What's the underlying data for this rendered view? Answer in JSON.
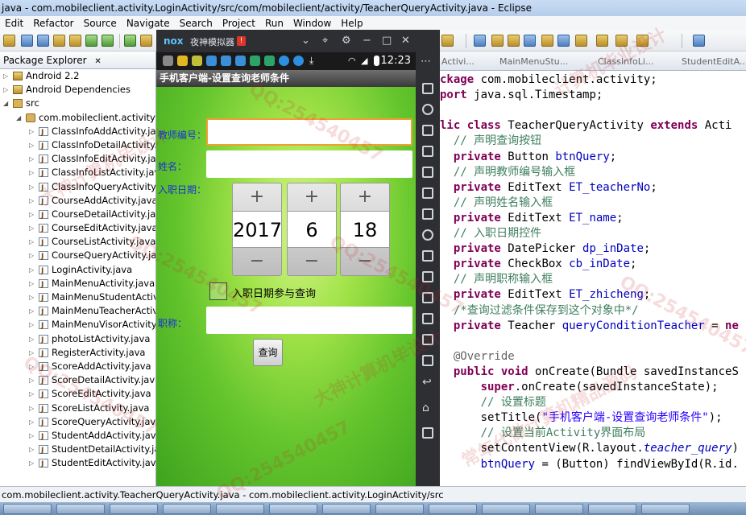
{
  "window": {
    "title": "java - com.mobileclient.activity.LoginActivity/src/com/mobileclient/activity/TeacherQueryActivity.java - Eclipse"
  },
  "menu": [
    "Edit",
    "Refactor",
    "Source",
    "Navigate",
    "Search",
    "Project",
    "Run",
    "Window",
    "Help"
  ],
  "package_explorer": {
    "tab": "Package Explorer",
    "items": [
      {
        "label": "Android 2.2",
        "icon": "library-icon"
      },
      {
        "label": "Android Dependencies",
        "icon": "library-icon"
      },
      {
        "label": "src",
        "icon": "source-folder-icon"
      },
      {
        "label": "com.mobileclient.activity",
        "icon": "package-icon"
      },
      {
        "label": "ClassInfoAddActivity.java",
        "icon": "java-file-icon"
      },
      {
        "label": "ClassInfoDetailActivity.java",
        "icon": "java-file-icon"
      },
      {
        "label": "ClassInfoEditActivity.java",
        "icon": "java-file-icon"
      },
      {
        "label": "ClassInfoListActivity.java",
        "icon": "java-file-icon"
      },
      {
        "label": "ClassInfoQueryActivity.java",
        "icon": "java-file-icon"
      },
      {
        "label": "CourseAddActivity.java",
        "icon": "java-file-icon"
      },
      {
        "label": "CourseDetailActivity.java",
        "icon": "java-file-icon"
      },
      {
        "label": "CourseEditActivity.java",
        "icon": "java-file-icon"
      },
      {
        "label": "CourseListActivity.java",
        "icon": "java-file-icon"
      },
      {
        "label": "CourseQueryActivity.java",
        "icon": "java-file-icon"
      },
      {
        "label": "LoginActivity.java",
        "icon": "java-file-icon"
      },
      {
        "label": "MainMenuActivity.java",
        "icon": "java-file-icon"
      },
      {
        "label": "MainMenuStudentActivity.java",
        "icon": "java-file-icon"
      },
      {
        "label": "MainMenuTeacherActivity.java",
        "icon": "java-file-icon"
      },
      {
        "label": "MainMenuVisorActivity.java",
        "icon": "java-file-icon"
      },
      {
        "label": "photoListActivity.java",
        "icon": "java-file-icon"
      },
      {
        "label": "RegisterActivity.java",
        "icon": "java-file-icon"
      },
      {
        "label": "ScoreAddActivity.java",
        "icon": "java-file-icon"
      },
      {
        "label": "ScoreDetailActivity.java",
        "icon": "java-file-icon"
      },
      {
        "label": "ScoreEditActivity.java",
        "icon": "java-file-icon"
      },
      {
        "label": "ScoreListActivity.java",
        "icon": "java-file-icon"
      },
      {
        "label": "ScoreQueryActivity.java",
        "icon": "java-file-icon"
      },
      {
        "label": "StudentAddActivity.java",
        "icon": "java-file-icon"
      },
      {
        "label": "StudentDetailActivity.java",
        "icon": "java-file-icon"
      },
      {
        "label": "StudentEditActivity.java",
        "icon": "java-file-icon"
      }
    ]
  },
  "editor": {
    "tabs": [
      "Activi...",
      "MainMenuStu...",
      "ClassInfoLi...",
      "StudentEditA..."
    ],
    "lines": [
      [
        {
          "t": "ckage ",
          "c": "kw"
        },
        {
          "t": "com.mobileclient.activity;",
          "c": ""
        }
      ],
      [
        {
          "t": "port ",
          "c": "kw"
        },
        {
          "t": "java.sql.Timestamp;",
          "c": ""
        }
      ],
      [
        {
          "t": "",
          "c": ""
        }
      ],
      [
        {
          "t": "lic ",
          "c": "kw"
        },
        {
          "t": "class ",
          "c": "kw"
        },
        {
          "t": "TeacherQueryActivity ",
          "c": ""
        },
        {
          "t": "extends ",
          "c": "kw"
        },
        {
          "t": "Acti",
          "c": ""
        }
      ],
      [
        {
          "t": "  // 声明查询按钮",
          "c": "cm"
        }
      ],
      [
        {
          "t": "  private ",
          "c": "kw"
        },
        {
          "t": "Button ",
          "c": ""
        },
        {
          "t": "btnQuery",
          "c": "fd"
        },
        {
          "t": ";",
          "c": ""
        }
      ],
      [
        {
          "t": "  // 声明教师编号输入框",
          "c": "cm"
        }
      ],
      [
        {
          "t": "  private ",
          "c": "kw"
        },
        {
          "t": "EditText ",
          "c": ""
        },
        {
          "t": "ET_teacherNo",
          "c": "fd"
        },
        {
          "t": ";",
          "c": ""
        }
      ],
      [
        {
          "t": "  // 声明姓名输入框",
          "c": "cm"
        }
      ],
      [
        {
          "t": "  private ",
          "c": "kw"
        },
        {
          "t": "EditText ",
          "c": ""
        },
        {
          "t": "ET_name",
          "c": "fd"
        },
        {
          "t": ";",
          "c": ""
        }
      ],
      [
        {
          "t": "  // 入职日期控件",
          "c": "cm"
        }
      ],
      [
        {
          "t": "  private ",
          "c": "kw"
        },
        {
          "t": "DatePicker ",
          "c": ""
        },
        {
          "t": "dp_inDate",
          "c": "fd"
        },
        {
          "t": ";",
          "c": ""
        }
      ],
      [
        {
          "t": "  private ",
          "c": "kw"
        },
        {
          "t": "CheckBox ",
          "c": ""
        },
        {
          "t": "cb_inDate",
          "c": "fd"
        },
        {
          "t": ";",
          "c": ""
        }
      ],
      [
        {
          "t": "  // 声明职称输入框",
          "c": "cm"
        }
      ],
      [
        {
          "t": "  private ",
          "c": "kw"
        },
        {
          "t": "EditText ",
          "c": ""
        },
        {
          "t": "ET_zhicheng",
          "c": "fd"
        },
        {
          "t": ";",
          "c": ""
        }
      ],
      [
        {
          "t": "  /*查询过滤条件保存到这个对象中*/",
          "c": "cm"
        }
      ],
      [
        {
          "t": "  private ",
          "c": "kw"
        },
        {
          "t": "Teacher ",
          "c": ""
        },
        {
          "t": "queryConditionTeacher",
          "c": "fd"
        },
        {
          "t": " = ",
          "c": ""
        },
        {
          "t": "ne",
          "c": "kw"
        }
      ],
      [
        {
          "t": "",
          "c": ""
        }
      ],
      [
        {
          "t": "  @Override",
          "c": "an"
        }
      ],
      [
        {
          "t": "  public ",
          "c": "kw"
        },
        {
          "t": "void ",
          "c": "kw"
        },
        {
          "t": "onCreate(Bundle savedInstanceS",
          "c": ""
        }
      ],
      [
        {
          "t": "      super",
          "c": "kw"
        },
        {
          "t": ".onCreate(savedInstanceState);",
          "c": ""
        }
      ],
      [
        {
          "t": "      // 设置标题",
          "c": "cm"
        }
      ],
      [
        {
          "t": "      setTitle(",
          "c": ""
        },
        {
          "t": "\"手机客户端-设置查询老师条件\"",
          "c": "st"
        },
        {
          "t": ");",
          "c": ""
        }
      ],
      [
        {
          "t": "      // 设置当前Activity界面布局",
          "c": "cm"
        }
      ],
      [
        {
          "t": "      setContentView(R.layout.",
          "c": ""
        },
        {
          "t": "teacher_query",
          "c": "it"
        },
        {
          "t": ")",
          "c": ""
        }
      ],
      [
        {
          "t": "      ",
          "c": ""
        },
        {
          "t": "btnQuery",
          "c": "fd"
        },
        {
          "t": " = (Button) findViewById(R.id.",
          "c": ""
        }
      ]
    ]
  },
  "status_bar": {
    "text": "com.mobileclient.activity.TeacherQueryActivity.java - com.mobileclient.activity.LoginActivity/src"
  },
  "emulator": {
    "logo": "nox",
    "name": "夜神模拟器",
    "warning_badge": "!",
    "time": "12:23",
    "app_title": "手机客户端-设置查询老师条件",
    "form": {
      "teacher_no_label": "教师编号：",
      "teacher_no_value": "",
      "name_label": "姓名：",
      "name_value": "",
      "in_date_label": "入职日期：",
      "year": "2017",
      "month": "6",
      "day": "18",
      "plus": "+",
      "minus": "−",
      "checkbox_label": "入职日期参与查询",
      "checkbox_checked": false,
      "zhicheng_label": "职称：",
      "zhicheng_value": "",
      "query_button": "查询"
    }
  },
  "watermarks": [
    "QQ:254540457",
    "大神计算机毕设计",
    "常年代做计算机精品源码",
    "计算机毕业设计"
  ],
  "colors": {
    "keyword": "#7f0055",
    "comment": "#3f7f5f",
    "field": "#0000c0",
    "string": "#2a00ff",
    "label_blue": "#1b30d8"
  }
}
